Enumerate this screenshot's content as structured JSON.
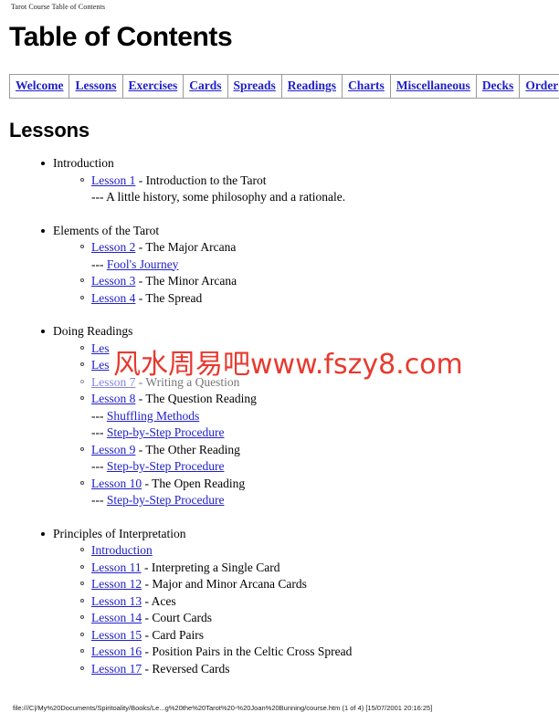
{
  "header": {
    "running_title": "Tarot Course Table of Contents"
  },
  "title": "Table of Contents",
  "nav": {
    "items": [
      {
        "label": "Welcome"
      },
      {
        "label": "Lessons"
      },
      {
        "label": "Exercises"
      },
      {
        "label": "Cards"
      },
      {
        "label": "Spreads"
      },
      {
        "label": "Readings"
      },
      {
        "label": "Charts"
      },
      {
        "label": "Miscellaneous"
      },
      {
        "label": "Decks"
      },
      {
        "label": "Order"
      }
    ]
  },
  "section": {
    "heading": "Lessons",
    "groups": [
      {
        "label": "Introduction",
        "entries": [
          {
            "kind": "lesson",
            "link": "Lesson 1",
            "rest": " - Introduction to the Tarot"
          },
          {
            "kind": "note",
            "dashes": "---",
            "plain": " A little history, some philosophy and a rationale."
          }
        ]
      },
      {
        "label": "Elements of the Tarot",
        "entries": [
          {
            "kind": "lesson",
            "link": "Lesson 2",
            "rest": " - The Major Arcana"
          },
          {
            "kind": "note",
            "dashes": "---",
            "link": "Fool's Journey"
          },
          {
            "kind": "lesson",
            "link": "Lesson 3",
            "rest": " - The Minor Arcana"
          },
          {
            "kind": "lesson",
            "link": "Lesson 4",
            "rest": " - The Spread"
          }
        ]
      },
      {
        "label": "Doing Readings",
        "entries": [
          {
            "kind": "lesson",
            "link": "Les",
            "rest": "",
            "obscured": true
          },
          {
            "kind": "lesson",
            "link": "Les",
            "rest": "",
            "obscured": true
          },
          {
            "kind": "lesson",
            "link": "Lesson 7",
            "rest": " - Writing a Question",
            "faded": true
          },
          {
            "kind": "lesson",
            "link": "Lesson 8",
            "rest": " - The Question Reading"
          },
          {
            "kind": "note",
            "dashes": "---",
            "link": "Shuffling Methods"
          },
          {
            "kind": "note",
            "dashes": "---",
            "link": "Step-by-Step Procedure"
          },
          {
            "kind": "lesson",
            "link": "Lesson 9",
            "rest": " - The Other Reading"
          },
          {
            "kind": "note",
            "dashes": "---",
            "link": "Step-by-Step Procedure"
          },
          {
            "kind": "lesson",
            "link": "Lesson 10",
            "rest": " - The Open Reading"
          },
          {
            "kind": "note",
            "dashes": "---",
            "link": "Step-by-Step Procedure"
          }
        ]
      },
      {
        "label": "Principles of Interpretation",
        "entries": [
          {
            "kind": "lesson",
            "link": "Introduction",
            "rest": ""
          },
          {
            "kind": "lesson",
            "link": "Lesson 11",
            "rest": " - Interpreting a Single Card"
          },
          {
            "kind": "lesson",
            "link": "Lesson 12",
            "rest": " - Major and Minor Arcana Cards"
          },
          {
            "kind": "lesson",
            "link": "Lesson 13",
            "rest": " - Aces"
          },
          {
            "kind": "lesson",
            "link": "Lesson 14",
            "rest": " - Court Cards"
          },
          {
            "kind": "lesson",
            "link": "Lesson 15",
            "rest": " - Card Pairs"
          },
          {
            "kind": "lesson",
            "link": "Lesson 16",
            "rest": " - Position Pairs in the Celtic Cross Spread"
          },
          {
            "kind": "lesson",
            "link": "Lesson 17",
            "rest": " - Reversed Cards"
          }
        ]
      }
    ]
  },
  "watermark": {
    "text": "风水周易吧www.fszy8.com",
    "color": "#e8392e"
  },
  "footer": {
    "text": "file:///C|/My%20Documents/Spiritoality/Books/Le...g%20the%20Tarot%20-%20Joan%20Bunning/course.htm (1 of 4) [15/07/2001 20:16:25]"
  },
  "colors": {
    "link": "#2020c8",
    "text": "#000000",
    "background": "#ffffff",
    "nav_border": "#9a9a9a"
  }
}
